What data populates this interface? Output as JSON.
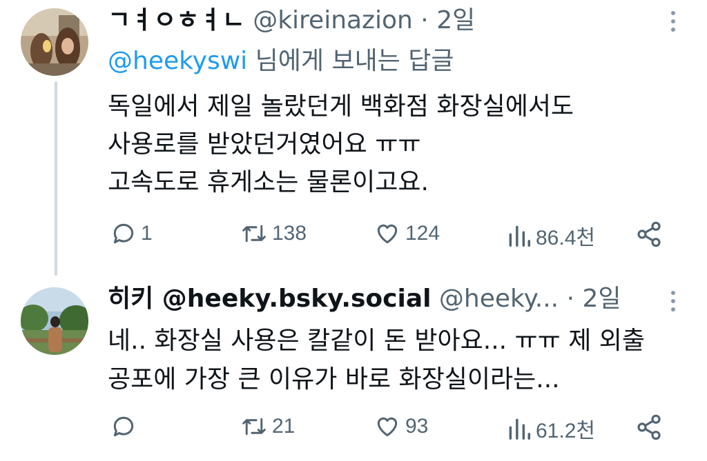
{
  "tweets": [
    {
      "display_name": "ㄱㅕㅇㅎㅕㄴ",
      "handle": "@kireinazion",
      "separator": "·",
      "time": "2일",
      "reply_mention": "@heekyswi",
      "reply_suffix": "님에게 보내는 답글",
      "lines": [
        "독일에서 제일 놀랐던게 백화점 화장실에서도",
        "사용로를 받았던거였어요 ㅠㅠ",
        "고속도로 휴게소는 물론이고요."
      ],
      "replies": "1",
      "reposts": "138",
      "likes": "124",
      "views": "86.4천"
    },
    {
      "display_name": "히키 @heeky.bsky.social",
      "handle": "@heeky...",
      "separator": "·",
      "time": "2일",
      "lines": [
        "네.. 화장실 사용은 칼같이 돈 받아요... ㅠㅠ 제 외출",
        "공포에 가장 큰 이유가 바로 화장실이라는..."
      ],
      "replies": "",
      "reposts": "21",
      "likes": "93",
      "views": "61.2천"
    }
  ],
  "icons": {
    "reply": "reply-bubble-icon",
    "repost": "repost-arrows-icon",
    "like": "heart-icon",
    "views": "bar-chart-icon",
    "share": "share-icon",
    "more": "more-vertical-icon"
  },
  "colors": {
    "text": "#0f1419",
    "muted": "#536471",
    "link": "#1d9bf0",
    "thread_line": "#cfd9de"
  }
}
